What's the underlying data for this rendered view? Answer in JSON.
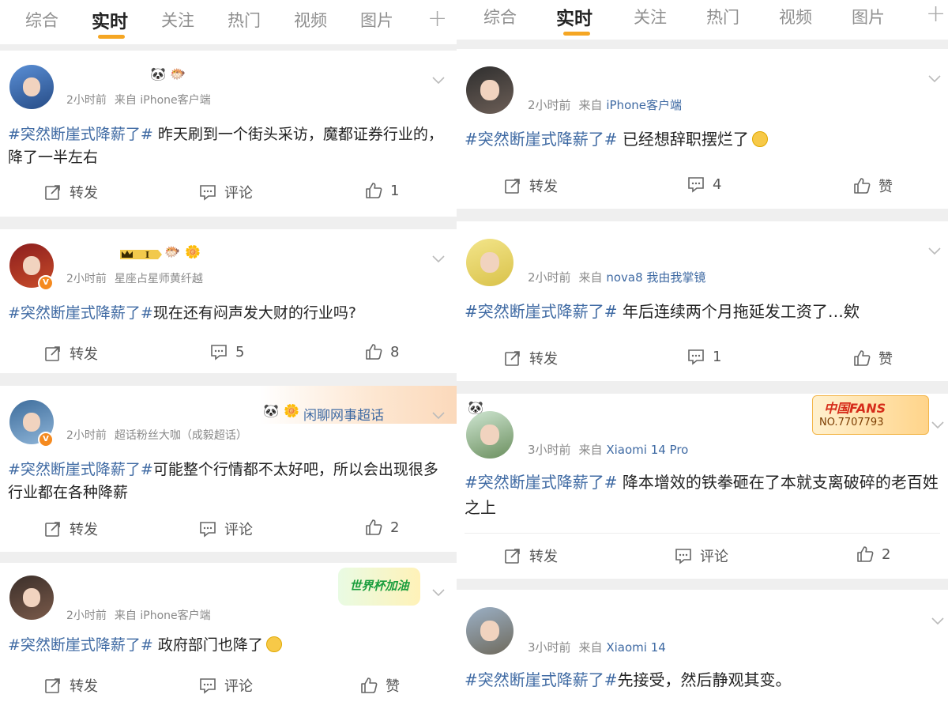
{
  "left": {
    "tabs": [
      "综合",
      "实时",
      "关注",
      "热门",
      "视频",
      "图片"
    ],
    "active_tab": "实时",
    "posts": [
      {
        "meta_time": "2小时前",
        "meta_source": "来自 iPhone客户端",
        "hashtag": "#突然断崖式降薪了#",
        "text": " 昨天刷到一个街头采访，魔都证券行业的，降了一半左右",
        "repost": "转发",
        "comment": "评论",
        "like": "1"
      },
      {
        "meta_time": "2小时前",
        "meta_source": "星座占星师黄纤越",
        "hashtag": "#突然断崖式降薪了#",
        "text": "现在还有闷声发大财的行业吗?",
        "repost": "转发",
        "comment": "5",
        "like": "8"
      },
      {
        "meta_time": "2小时前",
        "meta_source": "超话粉丝大咖（成毅超话）",
        "badge": "闲聊网事超话",
        "hashtag": "#突然断崖式降薪了#",
        "text": "可能整个行情都不太好吧，所以会出现很多行业都在各种降薪",
        "repost": "转发",
        "comment": "评论",
        "like": "2"
      },
      {
        "meta_time": "2小时前",
        "meta_source": "来自 iPhone客户端",
        "badge": "世界杯加油",
        "hashtag": "#突然断崖式降薪了#",
        "text": " 政府部门也降了",
        "repost": "转发",
        "comment": "评论",
        "like": "赞"
      }
    ]
  },
  "right": {
    "tabs": [
      "综合",
      "实时",
      "关注",
      "热门",
      "视频",
      "图片"
    ],
    "active_tab": "实时",
    "posts": [
      {
        "meta_time": "2小时前",
        "meta_source_prefix": "来自",
        "meta_source": "iPhone客户端",
        "hashtag": "#突然断崖式降薪了#",
        "text": " 已经想辞职摆烂了",
        "repost": "转发",
        "comment": "4",
        "like": "赞"
      },
      {
        "meta_time": "2小时前",
        "meta_source_prefix": "来自",
        "meta_source": "nova8 我由我掌镜",
        "hashtag": "#突然断崖式降薪了#",
        "text": " 年后连续两个月拖延发工资了…欸",
        "repost": "转发",
        "comment": "1",
        "like": "赞"
      },
      {
        "meta_time": "3小时前",
        "meta_source_prefix": "来自",
        "meta_source": "Xiaomi 14 Pro",
        "badge_line1": "中国FANS",
        "badge_line2": "NO.7707793",
        "hashtag": "#突然断崖式降薪了#",
        "text": " 降本增效的铁拳砸在了本就支离破碎的老百姓之上",
        "repost": "转发",
        "comment": "评论",
        "like": "2"
      },
      {
        "meta_time": "3小时前",
        "meta_source_prefix": "来自",
        "meta_source": "Xiaomi 14",
        "hashtag": "#突然断崖式降薪了#",
        "text": "先接受，然后静观其变。"
      }
    ]
  },
  "colors": {
    "link_blue": "#3f6aa3",
    "accent_orange": "#f5a623",
    "meta_gray": "#8a8a8a",
    "separator": "#efefef"
  }
}
